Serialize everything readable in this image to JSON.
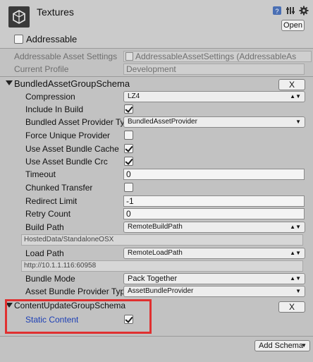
{
  "header": {
    "title": "Textures",
    "open_label": "Open",
    "addressable_label": "Addressable"
  },
  "settings": {
    "asset_settings_label": "Addressable Asset Settings",
    "asset_settings_value": "AddressableAssetSettings (AddressableAs",
    "current_profile_label": "Current Profile",
    "current_profile_value": "Development"
  },
  "bundled_schema": {
    "title": "BundledAssetGroupSchema",
    "remove_label": "X",
    "compression_label": "Compression",
    "compression_value": "LZ4",
    "include_in_build_label": "Include In Build",
    "include_in_build": true,
    "provider_type_label": "Bundled Asset Provider Ty",
    "provider_type_value": "BundledAssetProvider",
    "force_unique_label": "Force Unique Provider",
    "force_unique": false,
    "use_cache_label": "Use Asset Bundle Cache",
    "use_cache": true,
    "use_crc_label": "Use Asset Bundle Crc",
    "use_crc": true,
    "timeout_label": "Timeout",
    "timeout_value": "0",
    "chunked_label": "Chunked Transfer",
    "chunked": false,
    "redirect_label": "Redirect Limit",
    "redirect_value": "-1",
    "retry_label": "Retry Count",
    "retry_value": "0",
    "build_path_label": "Build Path",
    "build_path_value": "RemoteBuildPath",
    "build_path_resolved": "HostedData/StandaloneOSX",
    "load_path_label": "Load Path",
    "load_path_value": "RemoteLoadPath",
    "load_path_resolved": "http://10.1.1.116:60958",
    "bundle_mode_label": "Bundle Mode",
    "bundle_mode_value": "Pack Together",
    "bundle_provider_label": "Asset Bundle Provider Typ",
    "bundle_provider_value": "AssetBundleProvider"
  },
  "content_update_schema": {
    "title": "ContentUpdateGroupSchema",
    "remove_label": "X",
    "static_content_label": "Static Content",
    "static_content": true
  },
  "footer": {
    "add_schema_label": "Add Schema"
  },
  "colors": {
    "highlight": "#e03030",
    "static_content_text": "#1c3fb5"
  }
}
